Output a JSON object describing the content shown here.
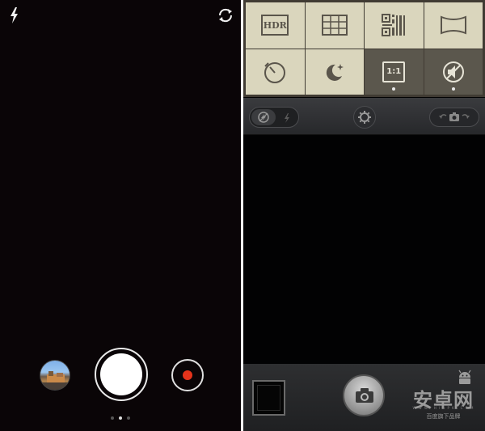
{
  "left_camera": {
    "icons": {
      "flash": "flash-bolt-icon",
      "switch_camera": "switch-camera-icon"
    },
    "pager": {
      "count": 3,
      "active_index": 1
    },
    "colors": {
      "record_dot": "#e5331b",
      "shutter": "#ffffff"
    }
  },
  "right_camera": {
    "mode_grid": [
      {
        "icon": "hdr-icon",
        "label": "HDR",
        "active": false
      },
      {
        "icon": "grid-icon",
        "active": false
      },
      {
        "icon": "qr-code-icon",
        "active": false
      },
      {
        "icon": "panorama-icon",
        "active": false
      },
      {
        "icon": "timer-icon",
        "active": false
      },
      {
        "icon": "night-mode-icon",
        "active": false
      },
      {
        "icon": "aspect-ratio-icon",
        "label": "1:1",
        "active": true
      },
      {
        "icon": "mute-icon",
        "active": true
      }
    ],
    "toolbar": {
      "icons": [
        "flash-off-icon",
        "flash-bolt-icon",
        "settings-gear-icon",
        "camera-mode-switch-icon"
      ]
    },
    "colors": {
      "grid_bg": "#dad6bd",
      "grid_active": "#5b574d"
    }
  },
  "watermark": {
    "logo": "安卓网",
    "url": "W W W . H I A P K . C O M",
    "slogan": "百度旗下品牌"
  }
}
